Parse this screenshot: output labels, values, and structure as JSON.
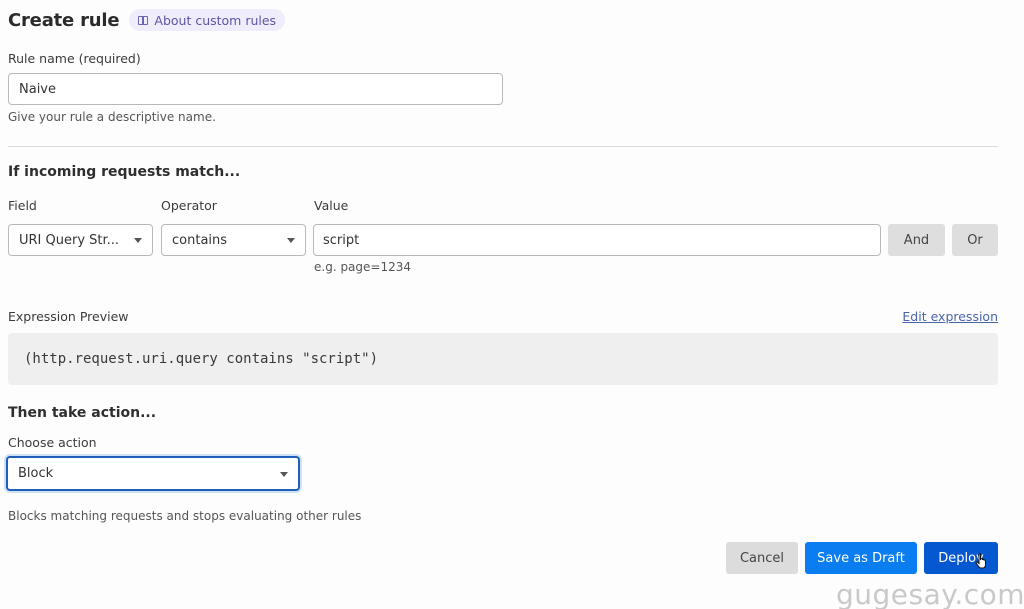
{
  "header": {
    "title": "Create rule",
    "about_link": "About custom rules",
    "about_icon": "book-icon"
  },
  "rule_name": {
    "label": "Rule name (required)",
    "value": "Naive",
    "hint": "Give your rule a descriptive name."
  },
  "match": {
    "heading": "If incoming requests match...",
    "field": {
      "label": "Field",
      "value": "URI Query Str..."
    },
    "operator": {
      "label": "Operator",
      "value": "contains"
    },
    "value": {
      "label": "Value",
      "value": "script",
      "hint": "e.g. page=1234"
    },
    "and_label": "And",
    "or_label": "Or"
  },
  "expression": {
    "label": "Expression Preview",
    "edit_link": "Edit expression",
    "text": "(http.request.uri.query contains \"script\")"
  },
  "action": {
    "heading": "Then take action...",
    "label": "Choose action",
    "value": "Block",
    "description": "Blocks matching requests and stops evaluating other rules"
  },
  "footer": {
    "cancel_label": "Cancel",
    "draft_label": "Save as Draft",
    "deploy_label": "Deploy"
  },
  "watermark": "gugesay.com",
  "colors": {
    "primary": "#0a7df0",
    "deploy": "#0658d0",
    "focus": "#1f5fb7",
    "pill_bg": "#efedfb",
    "link": "#4a64a8"
  }
}
